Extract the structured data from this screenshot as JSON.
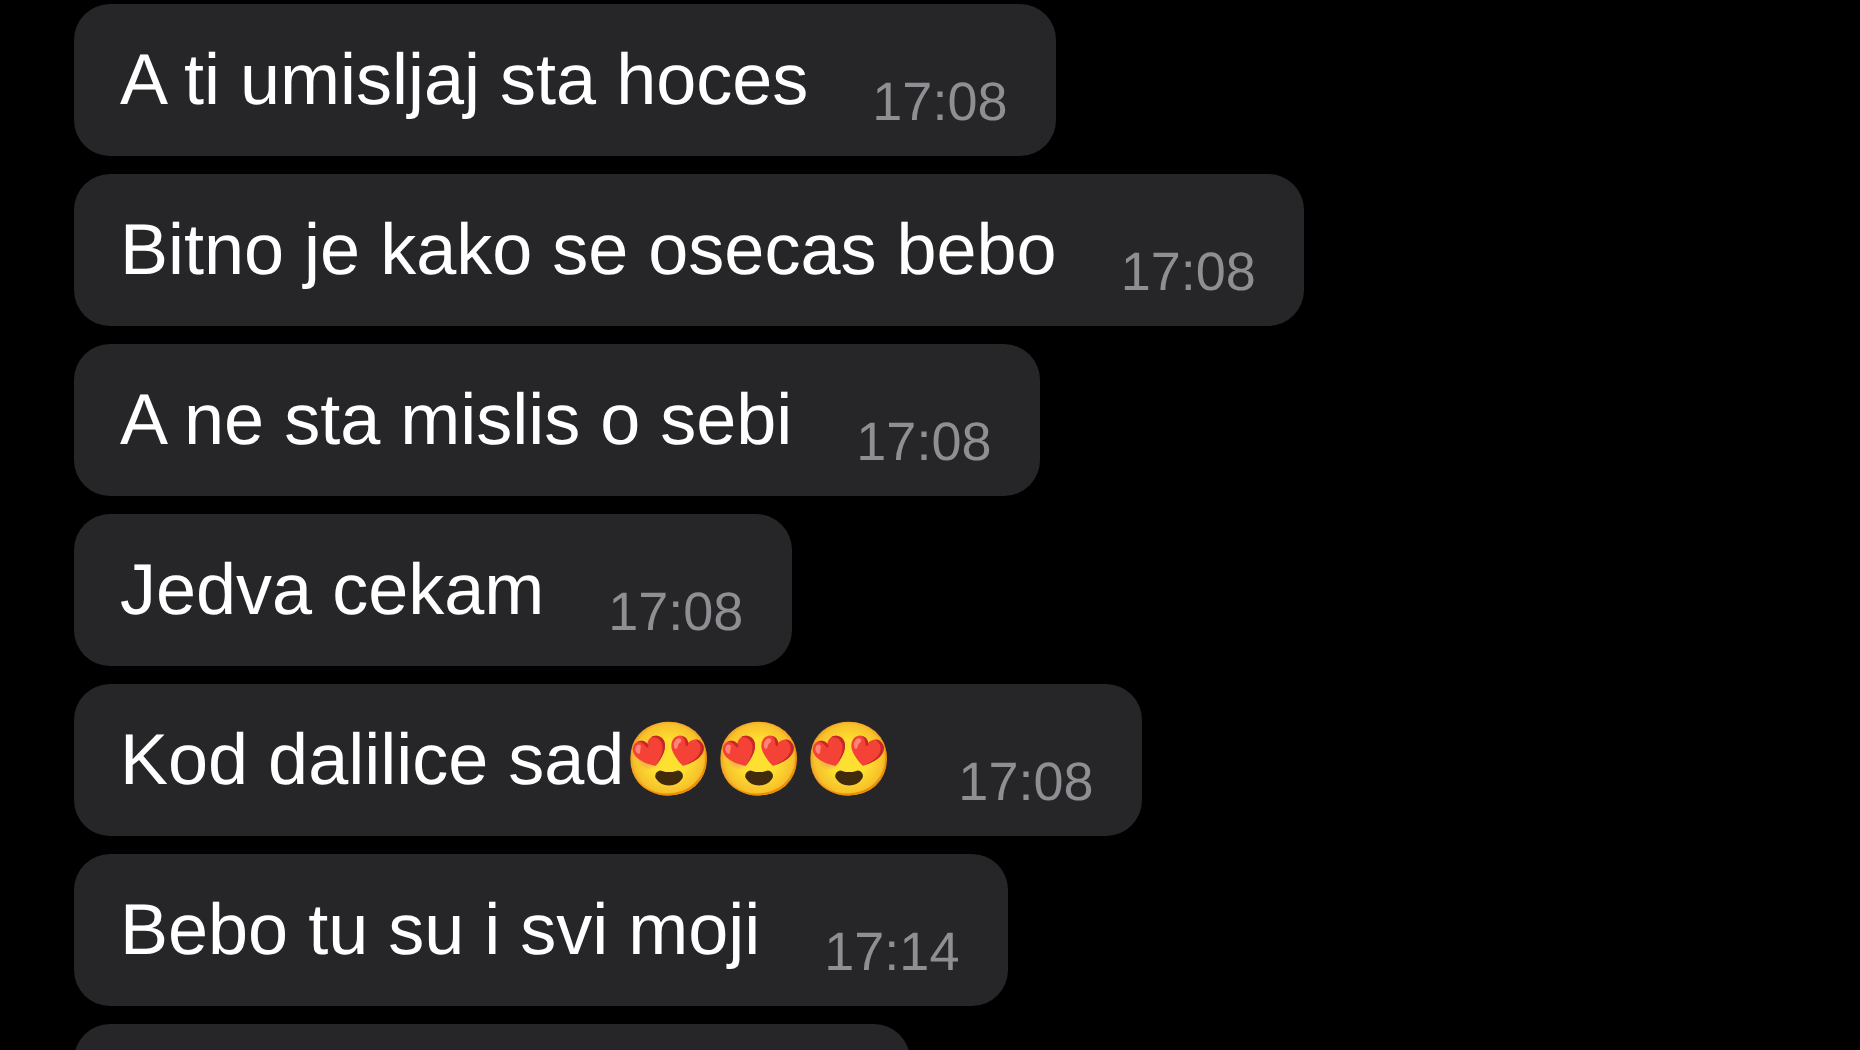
{
  "messages": [
    {
      "text": "A ti umisljaj sta hoces",
      "time": "17:08"
    },
    {
      "text": "Bitno je kako se osecas bebo",
      "time": "17:08"
    },
    {
      "text": "A ne sta mislis o sebi",
      "time": "17:08"
    },
    {
      "text": "Jedva cekam",
      "time": "17:08"
    },
    {
      "text": "Kod dalilice sad😍😍😍",
      "time": "17:08"
    },
    {
      "text": "Bebo tu su i svi moji",
      "time": "17:14"
    }
  ],
  "cut_off_bubble": true
}
